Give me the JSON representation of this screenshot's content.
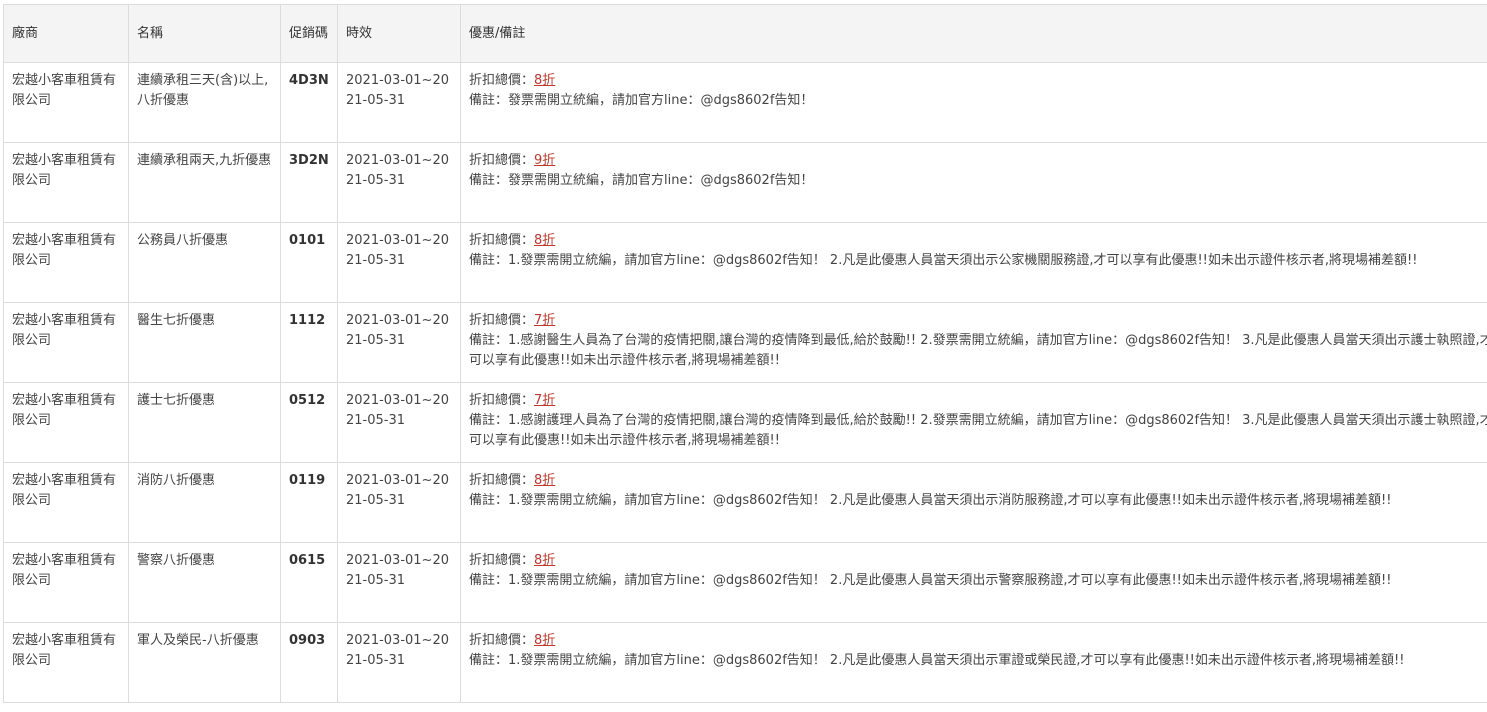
{
  "headers": [
    "廠商",
    "名稱",
    "促銷碼",
    "時效",
    "優惠/備註"
  ],
  "discount_label": "折扣總價：",
  "rows": [
    {
      "vendor": "宏越小客車租賃有限公司",
      "name": "連續承租三天(含)以上,八折優惠",
      "code": "4D3N",
      "period": "2021-03-01~2021-05-31",
      "discount": "8折",
      "note": "備註：發票需開立統編，請加官方line：@dgs8602f告知！"
    },
    {
      "vendor": "宏越小客車租賃有限公司",
      "name": "連續承租兩天,九折優惠",
      "code": "3D2N",
      "period": "2021-03-01~2021-05-31",
      "discount": "9折",
      "note": "備註：發票需開立統編，請加官方line：@dgs8602f告知！"
    },
    {
      "vendor": "宏越小客車租賃有限公司",
      "name": "公務員八折優惠",
      "code": "0101",
      "period": "2021-03-01~2021-05-31",
      "discount": "8折",
      "note": "備註：1.發票需開立統編，請加官方line：@dgs8602f告知！ 2.凡是此優惠人員當天須出示公家機關服務證,才可以享有此優惠!!如未出示證件核示者,將現場補差額!!"
    },
    {
      "vendor": "宏越小客車租賃有限公司",
      "name": "醫生七折優惠",
      "code": "1112",
      "period": "2021-03-01~2021-05-31",
      "discount": "7折",
      "note": "備註：1.感謝醫生人員為了台灣的疫情把關,讓台灣的疫情降到最低,給於鼓勵!! 2.發票需開立統編，請加官方line：@dgs8602f告知！ 3.凡是此優惠人員當天須出示護士執照證,才可以享有此優惠!!如未出示證件核示者,將現場補差額!!"
    },
    {
      "vendor": "宏越小客車租賃有限公司",
      "name": "護士七折優惠",
      "code": "0512",
      "period": "2021-03-01~2021-05-31",
      "discount": "7折",
      "note": "備註：1.感謝護理人員為了台灣的疫情把關,讓台灣的疫情降到最低,給於鼓勵!! 2.發票需開立統編，請加官方line：@dgs8602f告知！ 3.凡是此優惠人員當天須出示護士執照證,才可以享有此優惠!!如未出示證件核示者,將現場補差額!!"
    },
    {
      "vendor": "宏越小客車租賃有限公司",
      "name": "消防八折優惠",
      "code": "0119",
      "period": "2021-03-01~2021-05-31",
      "discount": "8折",
      "note": "備註：1.發票需開立統編，請加官方line：@dgs8602f告知！ 2.凡是此優惠人員當天須出示消防服務證,才可以享有此優惠!!如未出示證件核示者,將現場補差額!!"
    },
    {
      "vendor": "宏越小客車租賃有限公司",
      "name": "警察八折優惠",
      "code": "0615",
      "period": "2021-03-01~2021-05-31",
      "discount": "8折",
      "note": "備註：1.發票需開立統編，請加官方line：@dgs8602f告知！ 2.凡是此優惠人員當天須出示警察服務證,才可以享有此優惠!!如未出示證件核示者,將現場補差額!!"
    },
    {
      "vendor": "宏越小客車租賃有限公司",
      "name": "軍人及榮民-八折優惠",
      "code": "0903",
      "period": "2021-03-01~2021-05-31",
      "discount": "8折",
      "note": "備註：1.發票需開立統編，請加官方line：@dgs8602f告知！ 2.凡是此優惠人員當天須出示軍證或榮民證,才可以享有此優惠!!如未出示證件核示者,將現場補差額!!"
    }
  ]
}
